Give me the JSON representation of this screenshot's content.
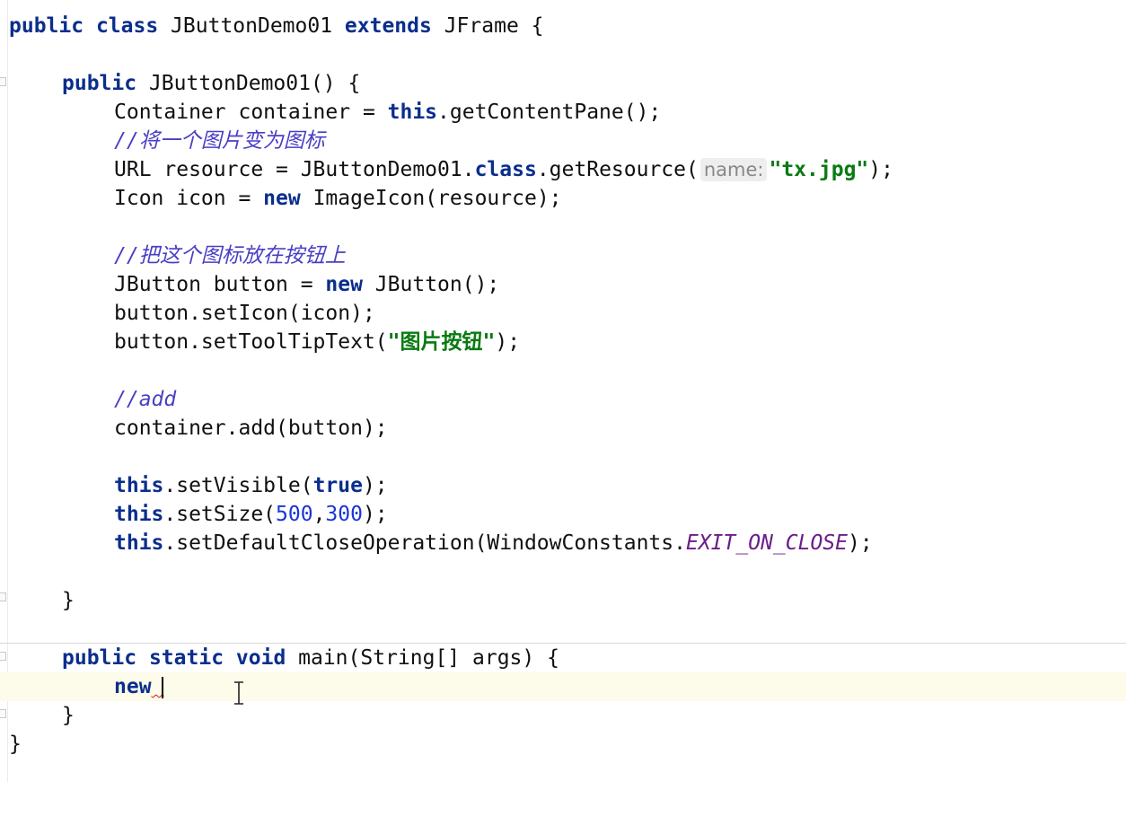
{
  "code": {
    "l1": {
      "kw1": "public",
      "sp1": " ",
      "kw2": "class",
      "t1": " JButtonDemo01 ",
      "kw3": "extends",
      "t2": " JFrame {"
    },
    "l2": {
      "kw1": "public",
      "t1": " JButtonDemo01() {"
    },
    "l3": {
      "t1": "Container container = ",
      "kw1": "this",
      "t2": ".getContentPane();"
    },
    "l4": {
      "comment": "//将一个图片变为图标"
    },
    "l5": {
      "t1": "URL resource = JButtonDemo01.",
      "kw1": "class",
      "t2": ".getResource(",
      "hint": "name:",
      "str": "\"tx.jpg\"",
      "t3": ");"
    },
    "l6": {
      "t1": "Icon icon = ",
      "kw1": "new",
      "t2": " ImageIcon(resource);"
    },
    "l7": {
      "comment": "//把这个图标放在按钮上"
    },
    "l8": {
      "t1": "JButton button = ",
      "kw1": "new",
      "t2": " JButton();"
    },
    "l9": {
      "t1": "button.setIcon(icon);"
    },
    "l10": {
      "t1": "button.setToolTipText(",
      "str": "\"图片按钮\"",
      "t2": ");"
    },
    "l11": {
      "comment": "//add"
    },
    "l12": {
      "t1": "container.add(button);"
    },
    "l13": {
      "kw1": "this",
      "t1": ".setVisible(",
      "kw2": "true",
      "t2": ");"
    },
    "l14": {
      "kw1": "this",
      "t1": ".setSize(",
      "num1": "500",
      "t2": ",",
      "num2": "300",
      "t3": ");"
    },
    "l15": {
      "kw1": "this",
      "t1": ".setDefaultCloseOperation(WindowConstants.",
      "const": "EXIT_ON_CLOSE",
      "t2": ");"
    },
    "l16": {
      "t1": "}"
    },
    "l17": {
      "kw1": "public",
      "kw2": "static",
      "kw3": "void",
      "t1": " main(String[] args) {"
    },
    "l18": {
      "kw1": "new",
      "t1": " "
    },
    "l19": {
      "t1": "}"
    },
    "l20": {
      "t1": "}"
    }
  }
}
